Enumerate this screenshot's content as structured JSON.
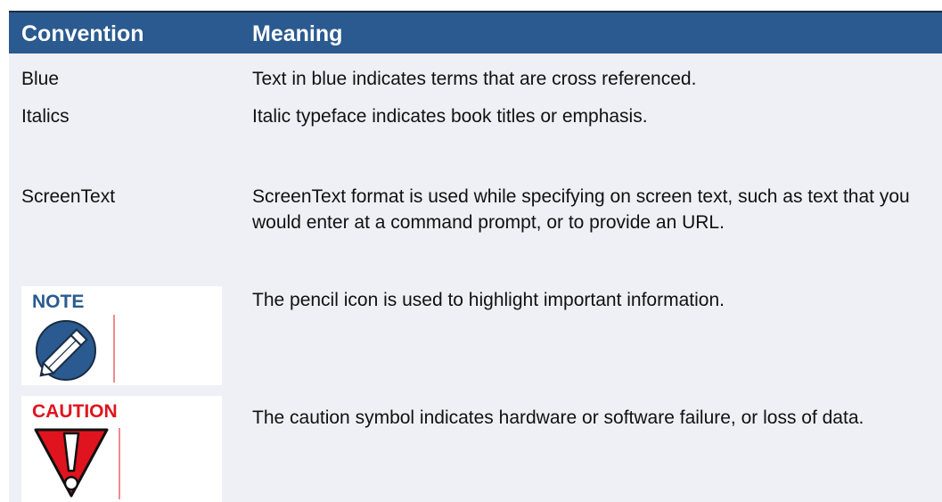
{
  "header": {
    "convention_label": "Convention",
    "meaning_label": "Meaning"
  },
  "rows": [
    {
      "convention": "Blue",
      "meaning": "Text in blue indicates terms that are cross referenced."
    },
    {
      "convention": "Italics",
      "meaning": "Italic typeface indicates book titles or emphasis."
    },
    {
      "convention": "ScreenText",
      "meaning": "ScreenText format is used while specifying on screen text, such as text that you would enter at a command prompt, or to provide an URL."
    },
    {
      "convention_label": "NOTE",
      "convention_icon": "pencil-icon",
      "meaning": "The pencil icon is used to highlight important information."
    },
    {
      "convention_label": "CAUTION",
      "convention_icon": "caution-exclamation-icon",
      "meaning": "The caution symbol indicates hardware or software failure, or loss of data."
    }
  ],
  "colors": {
    "header_bg": "#2a5a8f",
    "note_label": "#2a5a8f",
    "caution_label": "#e0141e",
    "row_bg": "#eef0f5"
  }
}
